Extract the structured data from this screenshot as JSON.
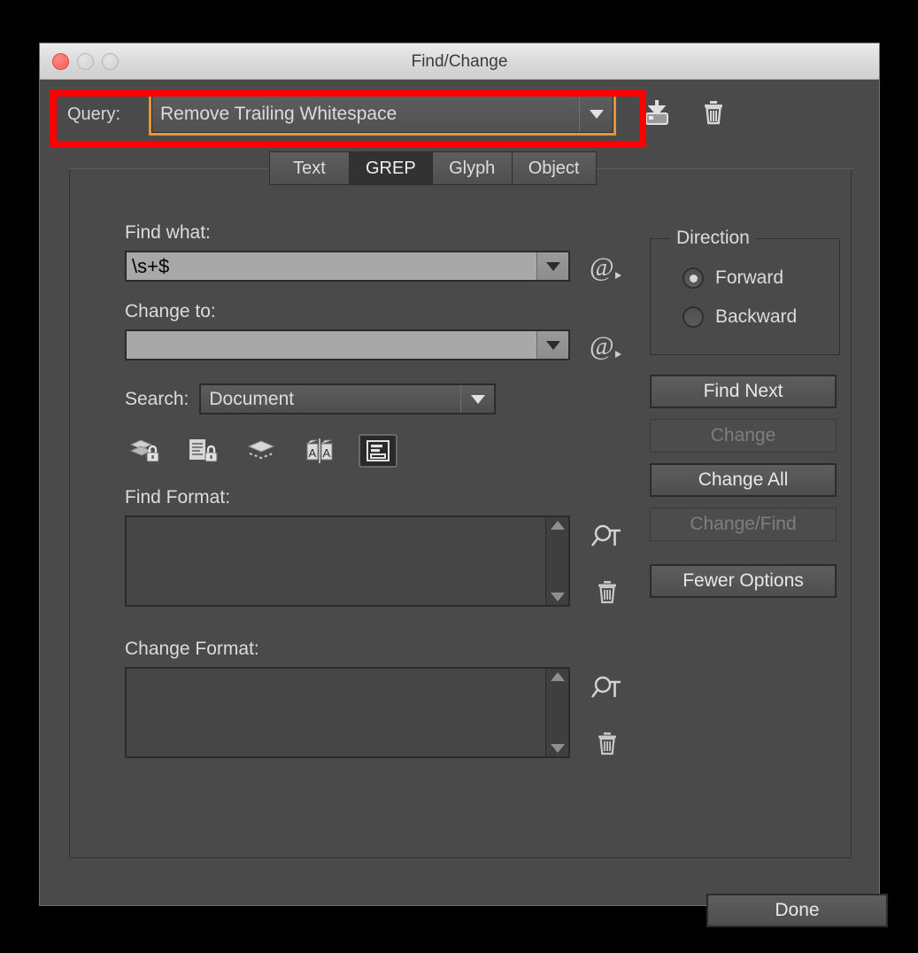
{
  "window": {
    "title": "Find/Change",
    "traffic_lights": [
      "close",
      "minimize",
      "zoom"
    ]
  },
  "query": {
    "label": "Query:",
    "value": "Remove Trailing Whitespace",
    "save_icon": "save-query-icon",
    "delete_icon": "delete-query-icon",
    "focus_color": "#e8923a"
  },
  "annotation": {
    "color": "#fe0000",
    "target": "query-row"
  },
  "tabs": [
    {
      "label": "Text",
      "active": false
    },
    {
      "label": "GREP",
      "active": true
    },
    {
      "label": "Glyph",
      "active": false
    },
    {
      "label": "Object",
      "active": false
    }
  ],
  "find": {
    "label": "Find what:",
    "value": "\\s+$",
    "special_icon": "at-special-characters-icon"
  },
  "change": {
    "label": "Change to:",
    "value": "",
    "special_icon": "at-special-characters-icon"
  },
  "search": {
    "label": "Search:",
    "value": "Document"
  },
  "toggles": [
    {
      "name": "include-locked-layers-icon",
      "on": false
    },
    {
      "name": "include-locked-stories-icon",
      "on": false
    },
    {
      "name": "include-hidden-layers-icon",
      "on": false
    },
    {
      "name": "include-master-pages-icon",
      "on": false
    },
    {
      "name": "include-footnotes-icon",
      "on": true
    }
  ],
  "find_format": {
    "label": "Find Format:",
    "value": "",
    "specify_icon": "specify-attributes-icon",
    "clear_icon": "clear-attributes-icon"
  },
  "change_format": {
    "label": "Change Format:",
    "value": "",
    "specify_icon": "specify-attributes-icon",
    "clear_icon": "clear-attributes-icon"
  },
  "direction": {
    "legend": "Direction",
    "options": [
      {
        "label": "Forward",
        "selected": true
      },
      {
        "label": "Backward",
        "selected": false
      }
    ]
  },
  "actions": {
    "find_next": {
      "label": "Find Next",
      "disabled": false
    },
    "change": {
      "label": "Change",
      "disabled": true
    },
    "change_all": {
      "label": "Change All",
      "disabled": false
    },
    "change_find": {
      "label": "Change/Find",
      "disabled": true
    },
    "options": {
      "label": "Fewer Options",
      "disabled": false
    }
  },
  "done": {
    "label": "Done"
  }
}
